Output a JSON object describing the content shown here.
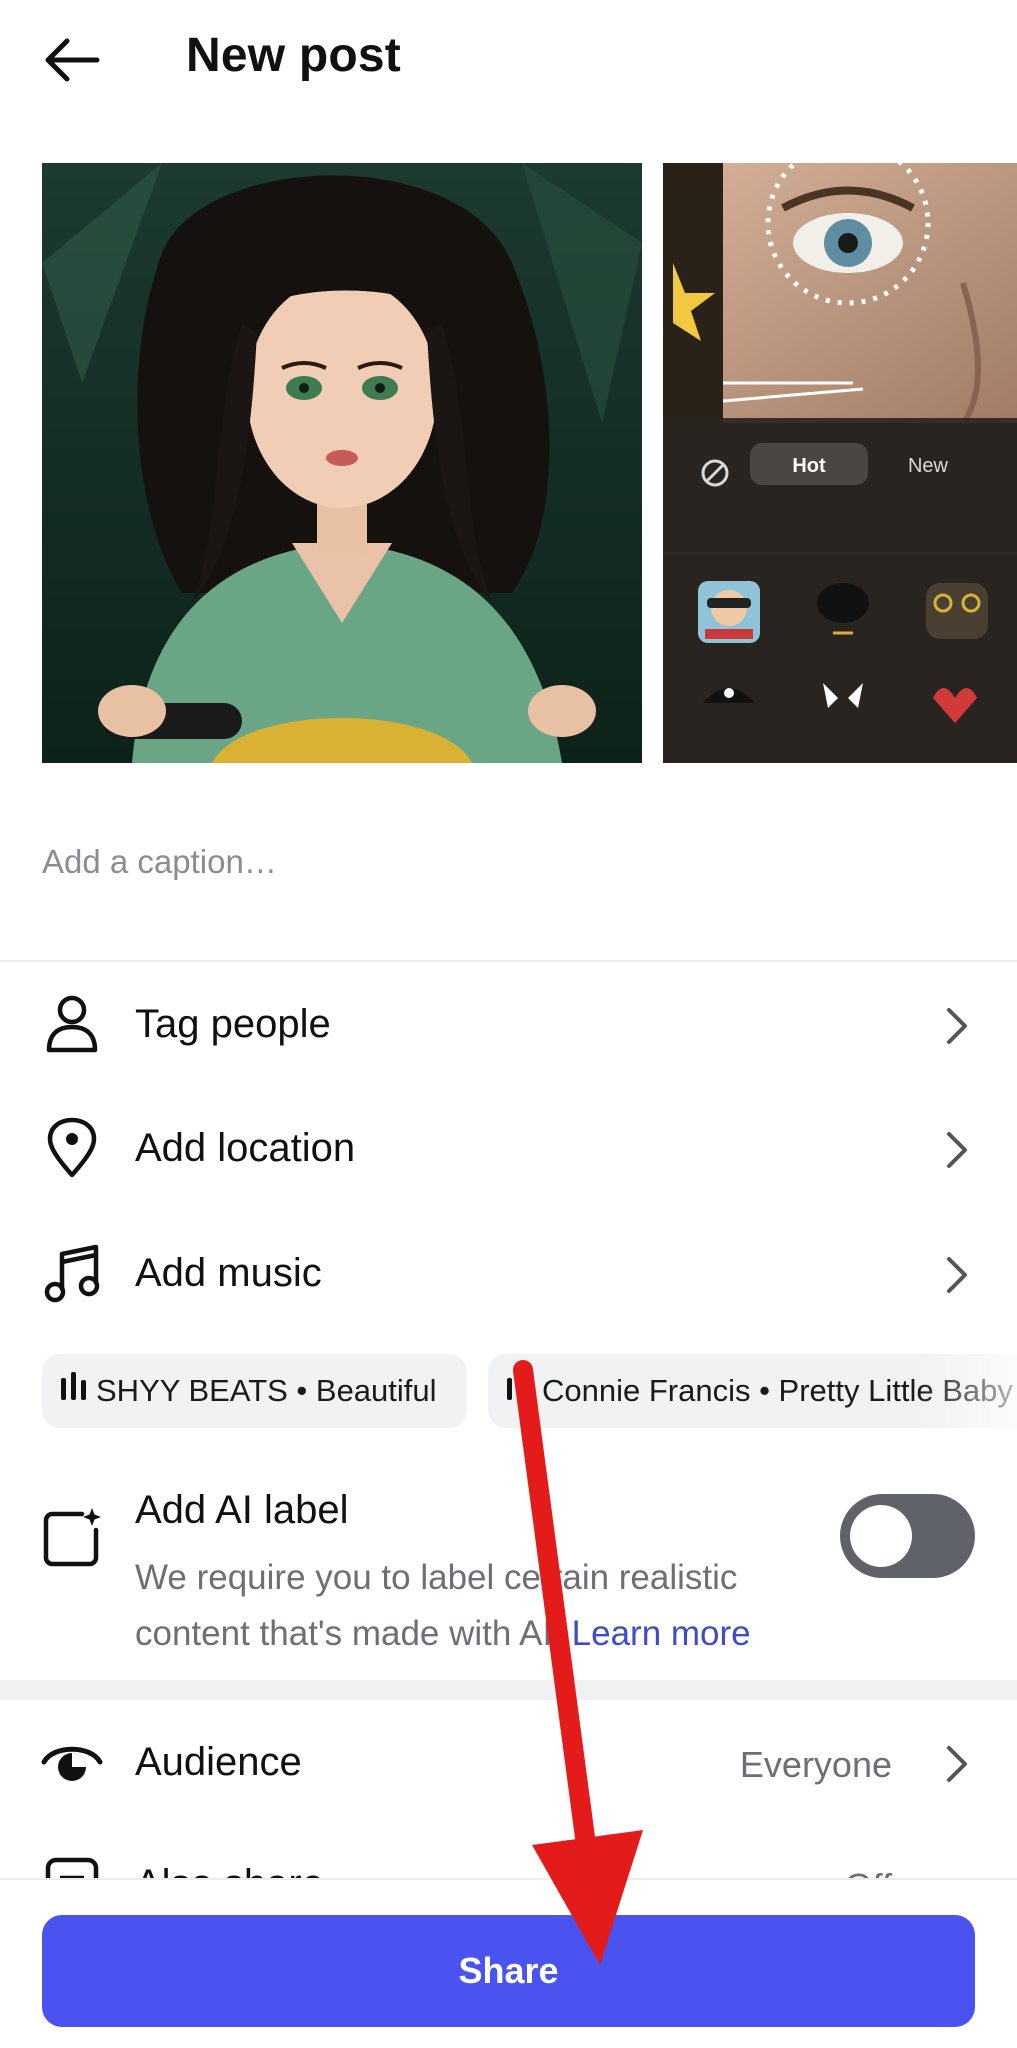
{
  "header": {
    "back_icon": "arrow-left-icon",
    "title": "New post"
  },
  "media": {
    "items": [
      {
        "kind": "illustration",
        "description_icon": "anime-portrait-image"
      },
      {
        "kind": "filter-preview",
        "tabs": [
          "Hot",
          "New"
        ],
        "no_filter_icon": "ban-icon"
      }
    ]
  },
  "caption": {
    "placeholder": "Add a caption…",
    "value": ""
  },
  "options": [
    {
      "label": "Tag people",
      "icon": "person-icon"
    },
    {
      "label": "Add location",
      "icon": "location-pin-icon"
    },
    {
      "label": "Add music",
      "icon": "music-note-icon"
    }
  ],
  "music_suggestions": [
    {
      "text": "SHYY BEATS • Beautiful",
      "icon": "sound-bars-icon"
    },
    {
      "text": "Connie Francis • Pretty Little Baby",
      "icon": "sound-bars-icon"
    }
  ],
  "ai_label": {
    "title": "Add AI label",
    "description": "We require you to label certain realistic content that's made with AI.",
    "learn_more": "Learn more",
    "enabled": false
  },
  "audience": {
    "label": "Audience",
    "value": "Everyone",
    "icon": "eye-icon"
  },
  "hidden_row": {
    "label": "Also share",
    "value": "Off"
  },
  "share_button": {
    "label": "Share",
    "color": "#4a53f0"
  },
  "annotation": {
    "color": "#e31b1b",
    "points_to": "share-button"
  }
}
